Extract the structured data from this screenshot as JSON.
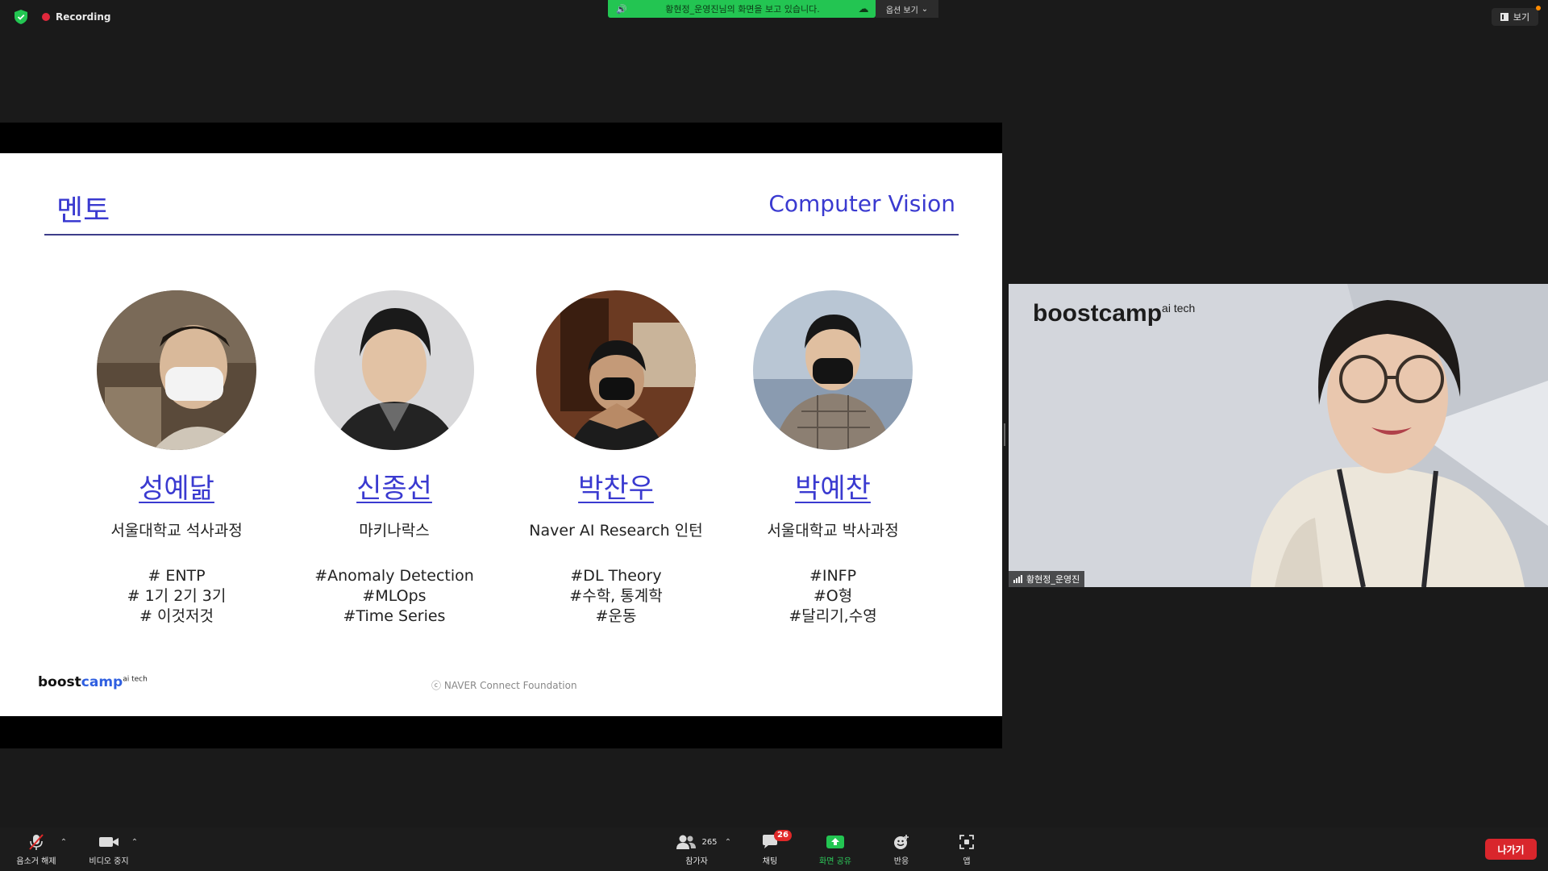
{
  "top_bar": {
    "recording_label": "Recording",
    "share_banner_text": "황현정_운영진님의 화면을 보고 있습니다.",
    "view_options_label": "옵션 보기",
    "view_button_label": "보기"
  },
  "slide": {
    "title": "멘토",
    "topic": "Computer Vision",
    "mentors": [
      {
        "name": "성예닮",
        "affiliation": "서울대학교 석사과정",
        "tags": [
          "# ENTP",
          "# 1기 2기 3기",
          "# 이것저것"
        ]
      },
      {
        "name": "신종선",
        "affiliation": "마키나락스",
        "tags": [
          "#Anomaly Detection",
          "#MLOps",
          "#Time Series"
        ]
      },
      {
        "name": "박찬우",
        "affiliation": "Naver AI Research 인턴",
        "tags": [
          "#DL Theory",
          "#수학, 통계학",
          "#운동"
        ]
      },
      {
        "name": "박예찬",
        "affiliation": "서울대학교 박사과정",
        "tags": [
          "#INFP",
          "#O형",
          "#달리기,수영"
        ]
      }
    ],
    "logo_boost": "boost",
    "logo_camp": "camp",
    "logo_sup": "ai tech",
    "footer": "ⓒ  NAVER Connect Foundation"
  },
  "video": {
    "brand_main": "boostcamp",
    "brand_sup": "ai tech",
    "participant_name": "황현정_운영진"
  },
  "toolbar": {
    "mute_label": "음소거 해제",
    "video_label": "비디오 중지",
    "participants_label": "참가자",
    "participants_count": "265",
    "chat_label": "채팅",
    "chat_badge": "26",
    "share_label": "화면 공유",
    "reactions_label": "반응",
    "apps_label": "앱",
    "leave_label": "나가기"
  },
  "colors": {
    "accent_blue": "#3a3ad0",
    "share_green": "#23c552",
    "record_red": "#e0283c",
    "leave_red": "#d9262c"
  }
}
